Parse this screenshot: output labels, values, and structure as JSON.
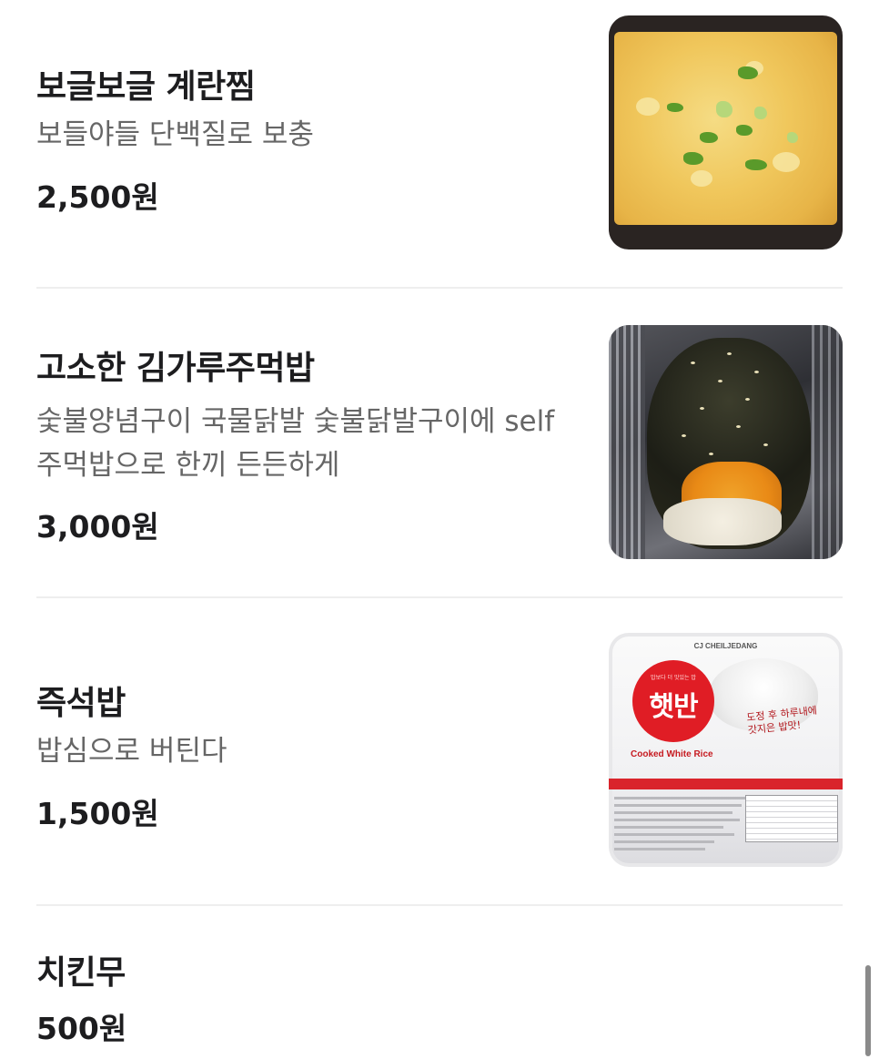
{
  "menu": {
    "items": [
      {
        "name": "보글보글 계란찜",
        "description": "보들야들 단백질로 보충",
        "price": "2,500원",
        "image_icon": "steamed-egg-photo"
      },
      {
        "name": "고소한 김가루주먹밥",
        "description": "숯불양념구이 국물닭발 숯불닭발구이에 self주먹밥으로 한끼 든든하게",
        "price": "3,000원",
        "image_icon": "seaweed-rice-ball-photo"
      },
      {
        "name": "즉석밥",
        "description": "밥심으로 버틴다",
        "price": "1,500원",
        "image_icon": "instant-rice-photo",
        "image_text": {
          "brand": "CJ CHEILJEDANG",
          "sub": "밥보다 더 맛있는 밥",
          "logo": "햇반",
          "english": "Cooked White Rice",
          "handwriting": "도정 후 하루내에 갓지은 밥맛!"
        }
      },
      {
        "name": "치킨무",
        "description": "",
        "price": "500원"
      }
    ]
  },
  "colors": {
    "name": "#1d1d1f",
    "description": "#666666",
    "divider": "#eeeeee",
    "background": "#ffffff",
    "scrollbar": "#8a8a8a",
    "hatban_red": "#e01d25"
  }
}
